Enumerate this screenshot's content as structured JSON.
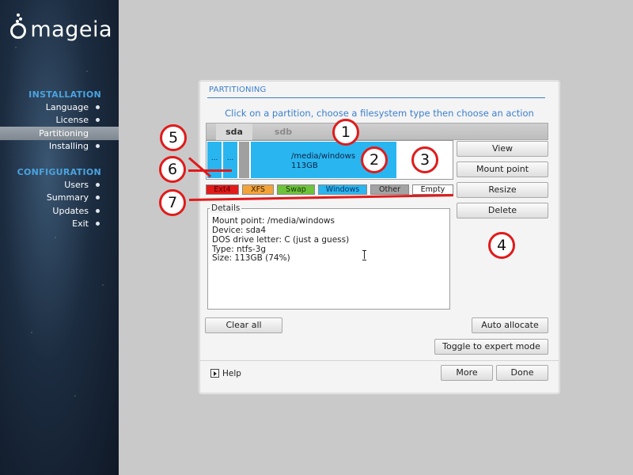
{
  "sidebar": {
    "logo_text": "mageia",
    "installation_heading": "INSTALLATION",
    "installation_items": [
      {
        "label": "Language"
      },
      {
        "label": "License"
      },
      {
        "label": "Partitioning"
      },
      {
        "label": "Installing"
      }
    ],
    "configuration_heading": "CONFIGURATION",
    "configuration_items": [
      {
        "label": "Users"
      },
      {
        "label": "Summary"
      },
      {
        "label": "Updates"
      },
      {
        "label": "Exit"
      }
    ]
  },
  "dialog": {
    "title": "PARTITIONING",
    "instructions": "Click on a partition, choose a filesystem type then choose an action",
    "tabs": [
      {
        "label": "sda"
      },
      {
        "label": "sdb"
      }
    ],
    "partitions": [
      {
        "label": "..."
      },
      {
        "label": "..."
      },
      {
        "label": ""
      },
      {
        "mount": "/media/windows",
        "size": "113GB"
      },
      {
        "label": ""
      }
    ],
    "action_buttons": {
      "view": "View",
      "mount_point": "Mount point",
      "resize": "Resize",
      "delete": "Delete"
    },
    "legend": [
      {
        "label": "Ext4",
        "color": "#e11a1a"
      },
      {
        "label": "XFS",
        "color": "#f2a33a"
      },
      {
        "label": "Swap",
        "color": "#6ec23c"
      },
      {
        "label": "Windows",
        "color": "#29b6f0"
      },
      {
        "label": "Other",
        "color": "#a3a3a3"
      },
      {
        "label": "Empty",
        "color": "#ffffff"
      }
    ],
    "details": {
      "legend": "Details",
      "lines": [
        "Mount point: /media/windows",
        "Device: sda4",
        "DOS drive letter: C (just a guess)",
        "Type: ntfs-3g",
        "Size: 113GB (74%)"
      ]
    },
    "buttons": {
      "clear_all": "Clear all",
      "auto_allocate": "Auto allocate",
      "toggle_expert": "Toggle to expert mode",
      "help": "Help",
      "more": "More",
      "done": "Done"
    }
  },
  "annotations": [
    {
      "number": "1"
    },
    {
      "number": "2"
    },
    {
      "number": "3"
    },
    {
      "number": "4"
    },
    {
      "number": "5"
    },
    {
      "number": "6"
    },
    {
      "number": "7"
    }
  ],
  "colors": {
    "accent": "#3b7ecf",
    "sidebar_heading": "#4aa3df",
    "annotation_red": "#e01b1b"
  }
}
